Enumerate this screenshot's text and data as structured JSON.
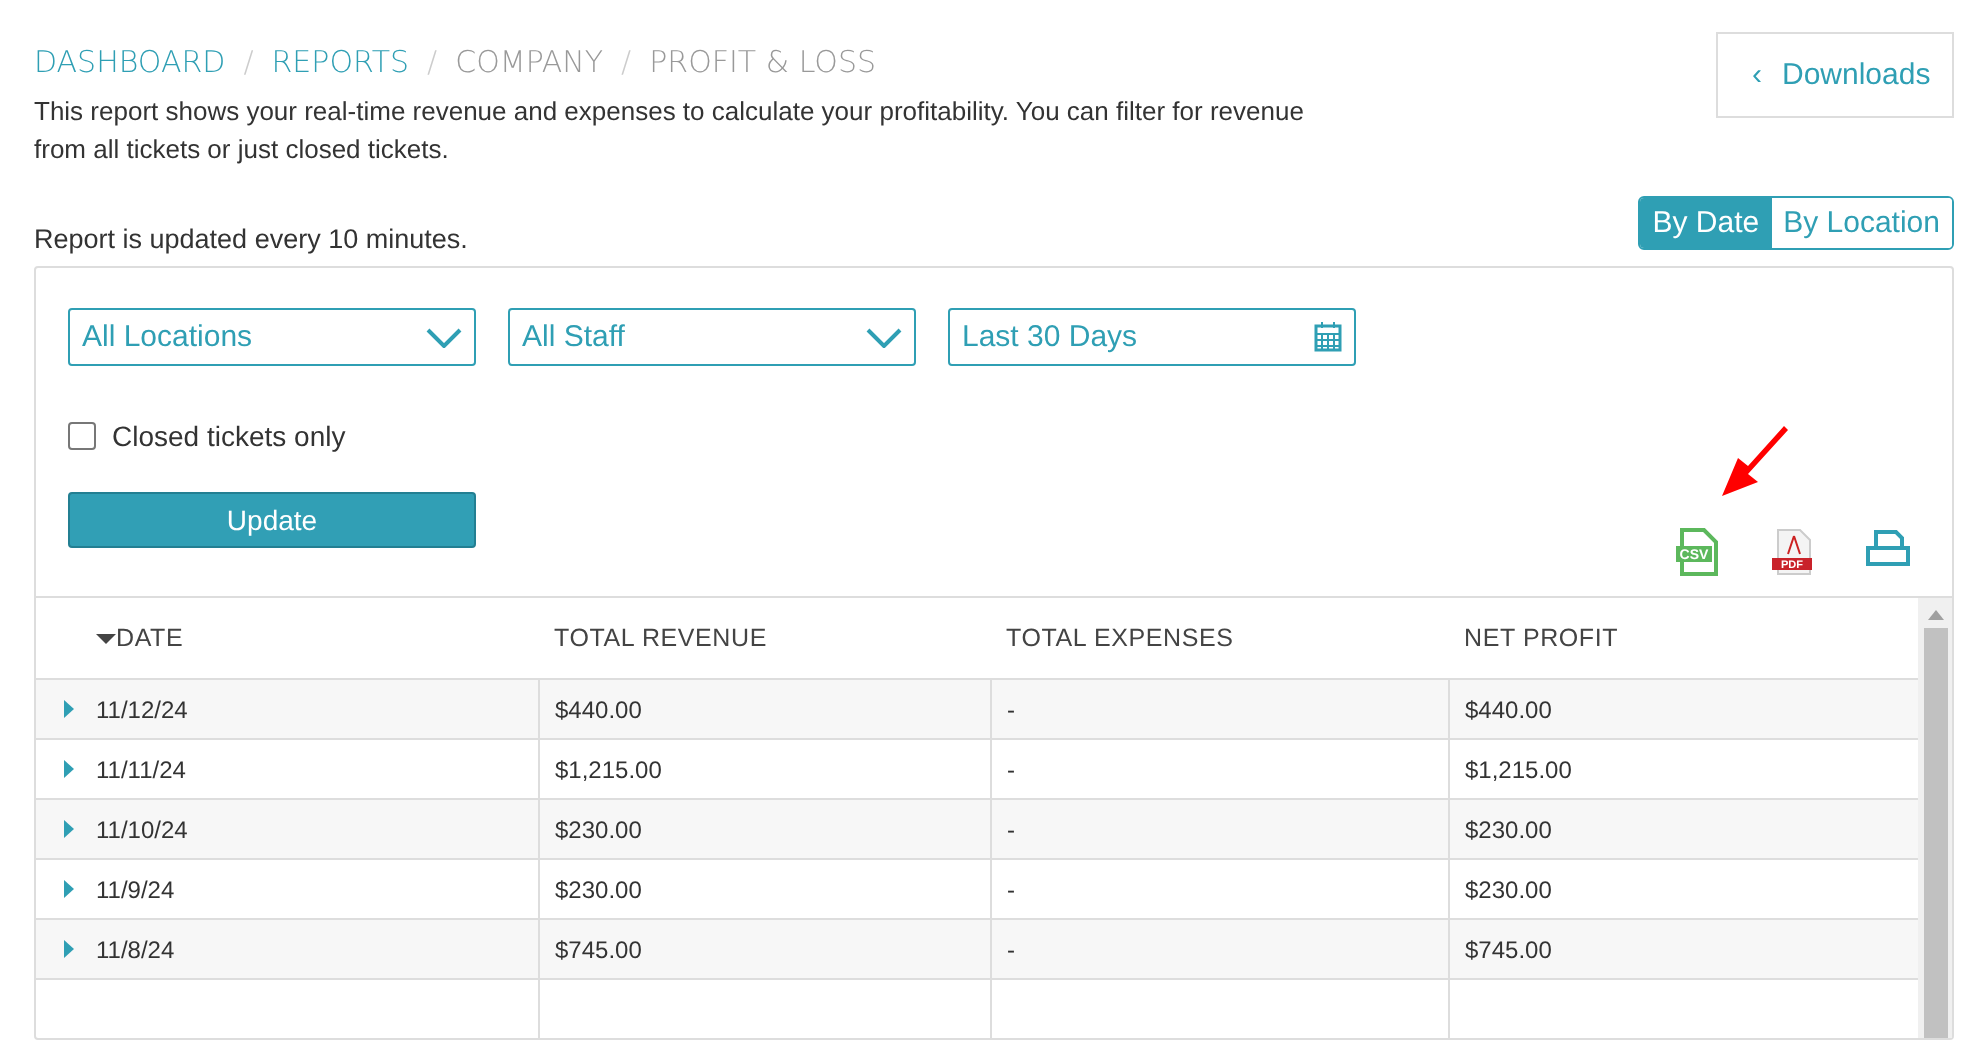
{
  "breadcrumbs": [
    {
      "label": "DASHBOARD",
      "link": true
    },
    {
      "separator": "/",
      "label": "REPORTS",
      "link": true
    },
    {
      "separator": "/",
      "label": "COMPANY",
      "link": false
    },
    {
      "separator": "/",
      "label": "PROFIT & LOSS",
      "link": false
    }
  ],
  "description": "This report shows your real-time revenue and expenses to calculate your profitability. You can filter for revenue from all tickets or just closed tickets.",
  "update_note": "Report is updated every 10 minutes.",
  "downloads_button": {
    "label": "Downloads",
    "icon": "‹"
  },
  "view_toggle": [
    {
      "label": "By Date",
      "selected": true
    },
    {
      "label": "By Location",
      "selected": false
    }
  ],
  "filters": [
    {
      "kind": "dropdown",
      "value": "All Locations"
    },
    {
      "kind": "dropdown",
      "value": "All Staff"
    },
    {
      "kind": "date",
      "value": "Last 30 Days"
    }
  ],
  "closed_tickets_only": {
    "label": "Closed tickets only",
    "checked": false
  },
  "update_button": "Update",
  "exports": [
    {
      "kind": "csv",
      "label": "CSV"
    },
    {
      "kind": "pdf",
      "label": "PDF"
    },
    {
      "kind": "print"
    }
  ],
  "table": {
    "columns": [
      {
        "label": "DATE",
        "sorted": true
      },
      {
        "label": "TOTAL REVENUE",
        "sorted": false
      },
      {
        "label": "TOTAL EXPENSES",
        "sorted": false
      },
      {
        "label": "NET PROFIT",
        "sorted": false
      }
    ],
    "rows": [
      {
        "expanded": false,
        "cells": [
          "11/12/24",
          "$440.00",
          "-",
          "$440.00"
        ]
      },
      {
        "expanded": false,
        "cells": [
          "11/11/24",
          "$1,215.00",
          "-",
          "$1,215.00"
        ]
      },
      {
        "expanded": false,
        "cells": [
          "11/10/24",
          "$230.00",
          "-",
          "$230.00"
        ]
      },
      {
        "expanded": false,
        "cells": [
          "11/9/24",
          "$230.00",
          "-",
          "$230.00"
        ]
      },
      {
        "expanded": false,
        "cells": [
          "11/8/24",
          "$745.00",
          "-",
          "$745.00"
        ]
      }
    ]
  }
}
